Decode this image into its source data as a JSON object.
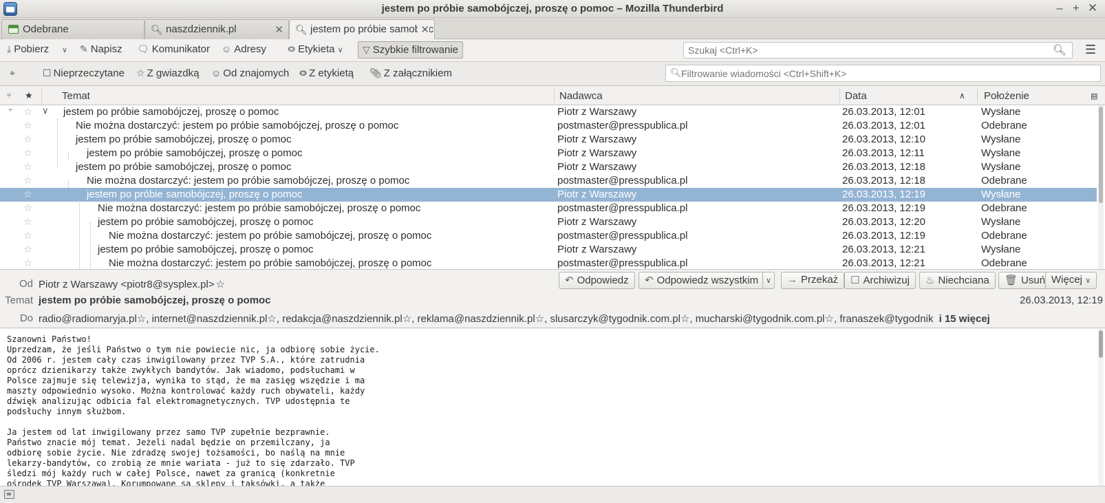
{
  "window": {
    "title": "jestem po próbie samobójczej, proszę o pomoc – Mozilla Thunderbird",
    "minimize": "–",
    "maximize": "+",
    "close": "✕"
  },
  "tabs": [
    {
      "label": "Odebrane",
      "icon": "inbox-icon"
    },
    {
      "label": "naszdziennik.pl",
      "icon": "search-icon",
      "close": "✕"
    },
    {
      "label": "jestem po próbie samobójczej, proszę o pomoc",
      "icon": "search-icon",
      "close": "✕"
    }
  ],
  "toolbar": {
    "get": "Pobierz",
    "write": "Napisz",
    "chat": "Komunikator",
    "address": "Adresy",
    "tag": "Etykieta",
    "quick_filter": "Szybkie filtrowanie",
    "search_placeholder": "Szukaj <Ctrl+K>"
  },
  "filterbar": {
    "unread": "Nieprzeczytane",
    "starred": "Z gwiazdką",
    "contacts": "Od znajomych",
    "tags": "Z etykietą",
    "attachments": "Z załącznikiem",
    "filter_placeholder": "Filtrowanie wiadomości <Ctrl+Shift+K>"
  },
  "columns": {
    "subject": "Temat",
    "sender": "Nadawca",
    "date": "Data",
    "location": "Położenie"
  },
  "messages": [
    {
      "subject": "jestem po próbie samobójczej, proszę o pomoc",
      "sender": "Piotr z Warszawy",
      "date": "26.03.2013, 12:01",
      "location": "Wysłane",
      "depth": 0
    },
    {
      "subject": "Nie można dostarczyć: jestem po próbie samobójczej, proszę o pomoc",
      "sender": "postmaster@presspublica.pl",
      "date": "26.03.2013, 12:01",
      "location": "Odebrane",
      "depth": 1
    },
    {
      "subject": "jestem po próbie samobójczej, proszę o pomoc",
      "sender": "Piotr z Warszawy",
      "date": "26.03.2013, 12:10",
      "location": "Wysłane",
      "depth": 1
    },
    {
      "subject": "jestem po próbie samobójczej, proszę o pomoc",
      "sender": "Piotr z Warszawy",
      "date": "26.03.2013, 12:11",
      "location": "Wysłane",
      "depth": 2
    },
    {
      "subject": "jestem po próbie samobójczej, proszę o pomoc",
      "sender": "Piotr z Warszawy",
      "date": "26.03.2013, 12:18",
      "location": "Wysłane",
      "depth": 1
    },
    {
      "subject": "Nie można dostarczyć: jestem po próbie samobójczej, proszę o pomoc",
      "sender": "postmaster@presspublica.pl",
      "date": "26.03.2013, 12:18",
      "location": "Odebrane",
      "depth": 2
    },
    {
      "subject": "jestem po próbie samobójczej, proszę o pomoc",
      "sender": "Piotr z Warszawy",
      "date": "26.03.2013, 12:19",
      "location": "Wysłane",
      "depth": 2,
      "selected": true
    },
    {
      "subject": "Nie można dostarczyć: jestem po próbie samobójczej, proszę o pomoc",
      "sender": "postmaster@presspublica.pl",
      "date": "26.03.2013, 12:19",
      "location": "Odebrane",
      "depth": 3
    },
    {
      "subject": "jestem po próbie samobójczej, proszę o pomoc",
      "sender": "Piotr z Warszawy",
      "date": "26.03.2013, 12:20",
      "location": "Wysłane",
      "depth": 3
    },
    {
      "subject": "Nie można dostarczyć: jestem po próbie samobójczej, proszę o pomoc",
      "sender": "postmaster@presspublica.pl",
      "date": "26.03.2013, 12:19",
      "location": "Odebrane",
      "depth": 4
    },
    {
      "subject": "jestem po próbie samobójczej, proszę o pomoc",
      "sender": "Piotr z Warszawy",
      "date": "26.03.2013, 12:21",
      "location": "Wysłane",
      "depth": 3
    },
    {
      "subject": "Nie można dostarczyć: jestem po próbie samobójczej, proszę o pomoc",
      "sender": "postmaster@presspublica.pl",
      "date": "26.03.2013, 12:21",
      "location": "Odebrane",
      "depth": 4
    }
  ],
  "header_buttons": {
    "reply": "Odpowiedz",
    "reply_all": "Odpowiedz wszystkim",
    "forward": "Przekaż",
    "archive": "Archiwizuj",
    "junk": "Niechciana",
    "delete": "Usuń",
    "more": "Więcej"
  },
  "message_header": {
    "from_label": "Od",
    "from": "Piotr z Warszawy <piotr8@sysplex.pl>",
    "subject_label": "Temat",
    "subject": "jestem po próbie samobójczej, proszę o pomoc",
    "date": "26.03.2013, 12:19",
    "to_label": "Do",
    "recipients": [
      "radio@radiomaryja.pl",
      "internet@naszdziennik.pl",
      "redakcja@naszdziennik.pl",
      "reklama@naszdziennik.pl",
      "slusarczyk@tygodnik.com.pl",
      "mucharski@tygodnik.com.pl",
      "franaszek@tygodnik"
    ],
    "more_recipients": "i 15 więcej"
  },
  "body": "Szanowni Państwo!\nUprzedzam, że jeśli Państwo o tym nie powiecie nic, ja odbiorę sobie życie.\nOd 2006 r. jestem cały czas inwigilowany przez TVP S.A., które zatrudnia\noprócz dzienikarzy także zwykłych bandytów. Jak wiadomo, podsłuchami w\nPolsce zajmuje się telewizja, wynika to stąd, że ma zasięg wszędzie i ma\nmaszty odpowiednio wysoko. Można kontrolować każdy ruch obywateli, każdy\ndźwięk analizując odbicia fal elektromagnetycznych. TVP udostępnia te\npodsłuchy innym służbom.\n\nJa jestem od lat inwigilowany przez samo TVP zupełnie bezprawnie.\nPaństwo znacie mój temat. Jeżeli nadal będzie on przemilczany, ja\nodbiorę sobie życie. Nie zdradzę swojej tożsamości, bo naślą na mnie\nlekarzy-bandytów, co zrobią ze mnie wariata - już to się zdarzało. TVP\nśledzi mój każdy ruch w całej Polsce, nawet za granicą (konkretnie\nośrodek TVP Warszawa). Korumpowane są sklepy i taksówki, a także"
}
